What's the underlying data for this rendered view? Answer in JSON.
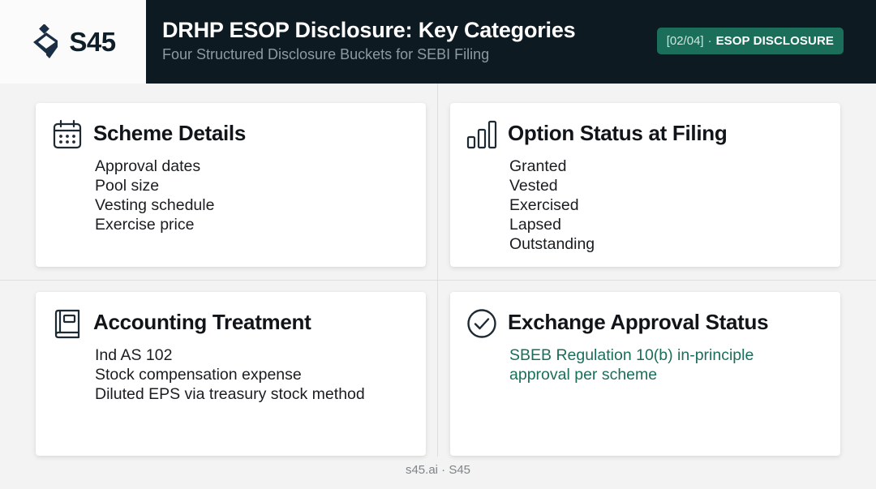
{
  "brand": {
    "logo_text": "S45",
    "accent_color": "#1a6e5a",
    "dark_color": "#0d1a22"
  },
  "header": {
    "title": "DRHP ESOP Disclosure: Key Categories",
    "subtitle": "Four Structured Disclosure Buckets for SEBI Filing",
    "badge": {
      "index": "[02/04]",
      "separator": "·",
      "label": "ESOP DISCLOSURE"
    }
  },
  "cards": [
    {
      "icon": "calendar-icon",
      "title": "Scheme Details",
      "items": [
        "Approval dates",
        "Pool size",
        "Vesting schedule",
        "Exercise price"
      ]
    },
    {
      "icon": "bar-chart-icon",
      "title": "Option Status at Filing",
      "items": [
        "Granted",
        "Vested",
        "Exercised",
        "Lapsed",
        "Outstanding"
      ]
    },
    {
      "icon": "book-icon",
      "title": "Accounting Treatment",
      "items": [
        "Ind AS 102",
        "Stock compensation expense",
        "Diluted EPS via treasury stock method"
      ]
    },
    {
      "icon": "check-circle-icon",
      "title": "Exchange Approval Status",
      "note": [
        "SBEB Regulation 10(b) in-principle",
        "approval per scheme"
      ]
    }
  ],
  "footer": {
    "text": "s45.ai · S45"
  }
}
